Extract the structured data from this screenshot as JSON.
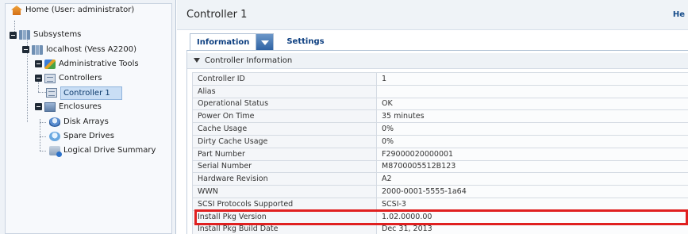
{
  "tree": {
    "items": [
      {
        "label": "Home (User: administrator)",
        "icon": "home-icon"
      },
      {
        "label": "Subsystems",
        "icon": "server-icon"
      },
      {
        "label": "localhost (Vess A2200)",
        "icon": "server-icon"
      },
      {
        "label": "Administrative Tools",
        "icon": "tools-icon"
      },
      {
        "label": "Controllers",
        "icon": "controller-icon"
      },
      {
        "label": "Controller 1",
        "icon": "controller-icon",
        "selected": true
      },
      {
        "label": "Enclosures",
        "icon": "enclosure-icon"
      },
      {
        "label": "Disk Arrays",
        "icon": "disk-array-icon"
      },
      {
        "label": "Spare Drives",
        "icon": "spare-drive-icon"
      },
      {
        "label": "Logical Drive Summary",
        "icon": "logical-drive-icon"
      }
    ]
  },
  "header": {
    "title": "Controller 1",
    "help": "He"
  },
  "tabs": {
    "information": "Information",
    "settings": "Settings"
  },
  "section": {
    "title": "Controller Information"
  },
  "properties": [
    {
      "key": "Controller ID",
      "value": "1"
    },
    {
      "key": "Alias",
      "value": ""
    },
    {
      "key": "Operational Status",
      "value": "OK"
    },
    {
      "key": "Power On Time",
      "value": "35 minutes"
    },
    {
      "key": "Cache Usage",
      "value": "0%"
    },
    {
      "key": "Dirty Cache Usage",
      "value": "0%"
    },
    {
      "key": "Part Number",
      "value": "F29000020000001"
    },
    {
      "key": "Serial Number",
      "value": "M8700005512B123"
    },
    {
      "key": "Hardware Revision",
      "value": "A2"
    },
    {
      "key": "WWN",
      "value": "2000-0001-5555-1a64"
    },
    {
      "key": "SCSI Protocols Supported",
      "value": "SCSI-3"
    },
    {
      "key": "Install Pkg Version",
      "value": "1.02.0000.00"
    },
    {
      "key": "Install Pkg Build Date",
      "value": "Dec 31, 2013"
    }
  ],
  "colors": {
    "highlight": "#e02020",
    "selected": "#c9def5",
    "link": "#0d3f80"
  }
}
